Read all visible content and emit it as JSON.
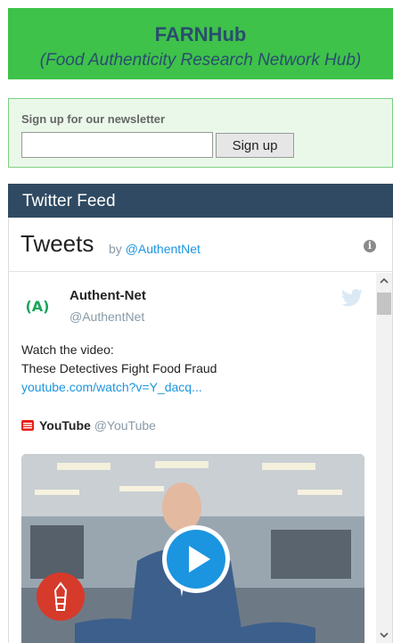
{
  "header": {
    "title": "FARNHub",
    "subtitle": "(Food Authenticity Research Network Hub)"
  },
  "newsletter": {
    "label": "Sign up for our newsletter",
    "input_value": "",
    "button_label": "Sign up"
  },
  "feed": {
    "title": "Twitter Feed"
  },
  "widget": {
    "title": "Tweets",
    "by_prefix": "by ",
    "by_handle": "@AuthentNet",
    "info_icon": "info-icon"
  },
  "tweet": {
    "avatar_text": "(A)",
    "author_name": "Authent-Net",
    "author_handle": "@AuthentNet",
    "text_line1": "Watch the video:",
    "text_line2": "These Detectives Fight Food Fraud",
    "link": "youtube.com/watch?v=Y_dacq...",
    "card_source_name": "YouTube",
    "card_source_handle": " @YouTube"
  },
  "colors": {
    "header_bg": "#3ec24a",
    "header_text": "#2a4d6e",
    "feed_bar_bg": "#2f4a62",
    "link": "#1b95e0",
    "play_button": "#1da1f2"
  }
}
